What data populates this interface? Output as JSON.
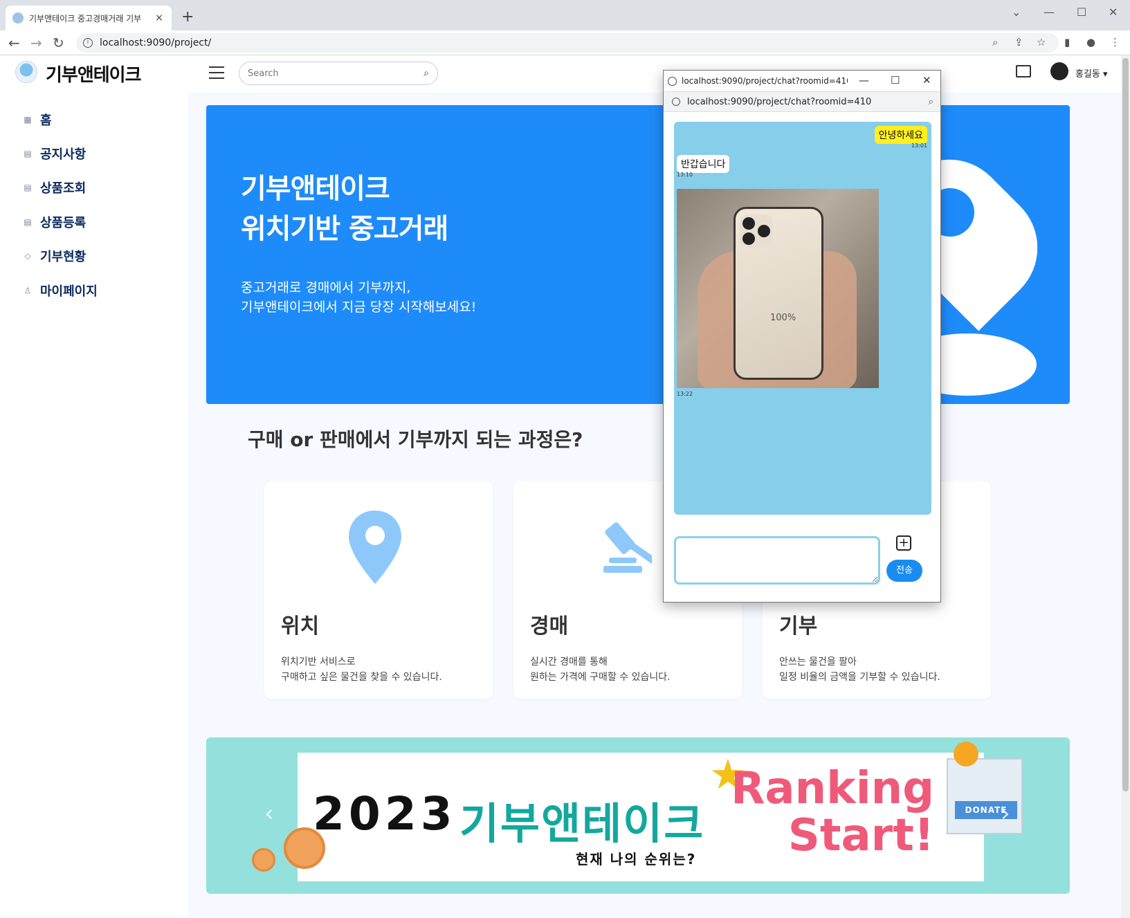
{
  "browser": {
    "tab_title": "기부앤테이크 중고경매거래 기부",
    "tab_close": "×",
    "new_tab": "+",
    "url": "localhost:9090/project/",
    "win_min": "—",
    "win_max": "☐",
    "win_close": "✕",
    "win_dropdown": "⌄",
    "back": "←",
    "forward": "→",
    "reload": "↻"
  },
  "header": {
    "logo_text": "기부앤테이크",
    "search_placeholder": "Search",
    "user_name": "홍길동 ▾"
  },
  "sidebar": {
    "items": [
      {
        "label": "홈",
        "icon": "grid-icon"
      },
      {
        "label": "공지사항",
        "icon": "document-icon"
      },
      {
        "label": "상품조회",
        "icon": "list-icon"
      },
      {
        "label": "상품등록",
        "icon": "list-icon"
      },
      {
        "label": "기부현황",
        "icon": "gem-icon"
      },
      {
        "label": "마이페이지",
        "icon": "person-icon"
      }
    ]
  },
  "hero": {
    "title": "기부앤테이크\n위치기반 중고거래",
    "subtitle": "중고거래로 경매에서 기부까지,\n기부앤테이크에서 지금 당장 시작해보세요!"
  },
  "process": {
    "title": "구매 or 판매에서 기부까지 되는 과정은?",
    "cards": [
      {
        "title": "위치",
        "desc": "위치기반 서비스로\n구매하고 싶은 물건을 찾을 수 있습니다.",
        "icon": "map-pin-icon"
      },
      {
        "title": "경매",
        "desc": "실시간 경매를 통해\n원하는 가격에 구매할 수 있습니다.",
        "icon": "gavel-icon"
      },
      {
        "title": "기부",
        "desc": "안쓰는 물건을 팔아\n일정 비율의 금액을 기부할 수 있습니다.",
        "icon": "donate-icon"
      }
    ]
  },
  "banner": {
    "year": "2023",
    "brand": "기부앤테이크",
    "sub": "현재 나의 순위는?",
    "ranking": "Ranking\nStart!",
    "donate": "DONATE",
    "prev": "‹",
    "next": "›"
  },
  "popup": {
    "title": "localhost:9090/project/chat?roomid=410...",
    "url": "localhost:9090/project/chat?roomid=410",
    "min": "—",
    "max": "☐",
    "close": "✕",
    "messages": [
      {
        "text": "안녕하세요",
        "time": "13:01",
        "side": "mine"
      },
      {
        "text": "반갑습니다",
        "time": "13:10",
        "side": "theirs"
      },
      {
        "text": "",
        "time": "13:22",
        "side": "theirs",
        "type": "image"
      }
    ],
    "photo_text": "100%",
    "plus": "+",
    "send": "전송"
  },
  "colors": {
    "hero_bg": "#1e8bfb",
    "chat_bg": "#87ceea",
    "mine_bubble": "#ffef1e",
    "send_btn": "#1a8cf0",
    "banner_bg": "#94e0dc"
  }
}
